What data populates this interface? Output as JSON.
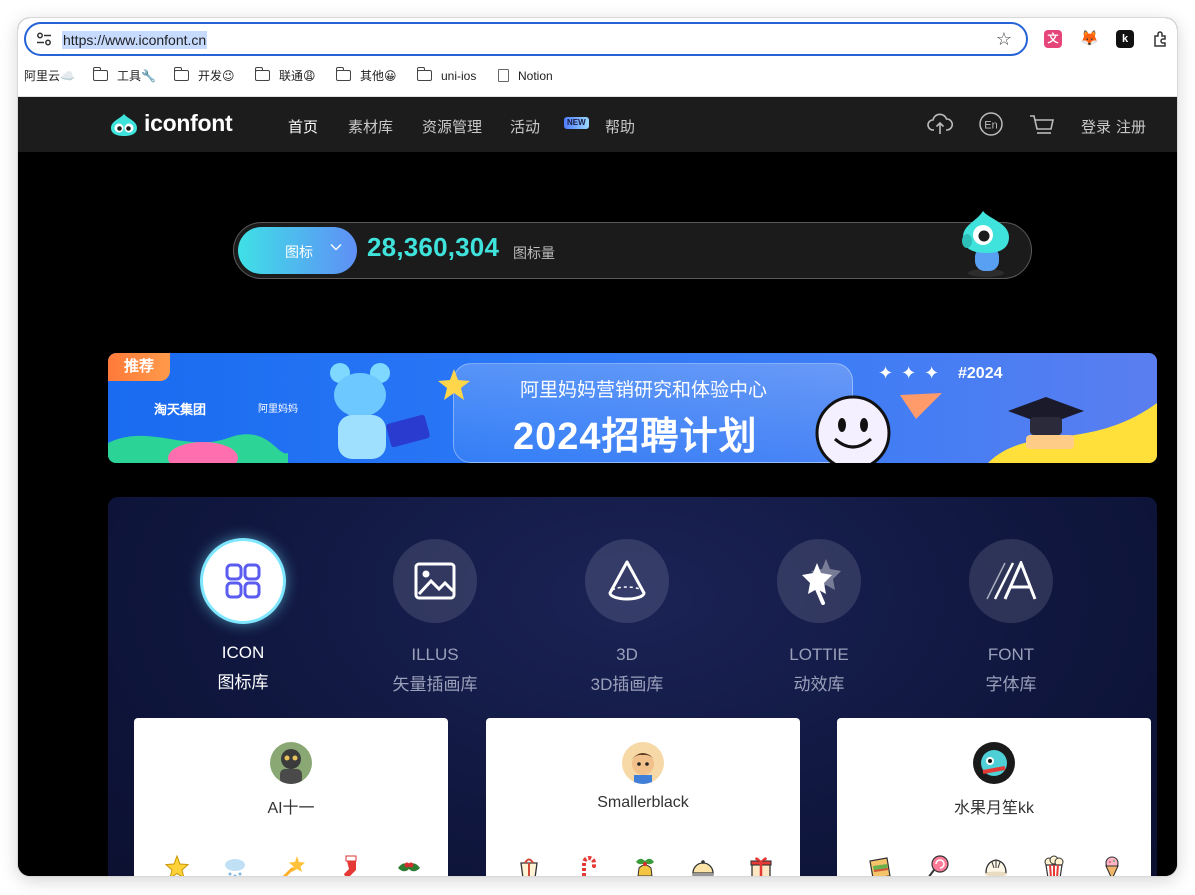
{
  "browser": {
    "url": "https://www.iconfont.cn",
    "bookmarks": [
      {
        "label": "阿里云☁️",
        "type": "text"
      },
      {
        "label": "工具🔧",
        "type": "folder"
      },
      {
        "label": "开发😉",
        "type": "folder"
      },
      {
        "label": "联通😩",
        "type": "folder"
      },
      {
        "label": "其他😀",
        "type": "folder"
      },
      {
        "label": "uni-ios",
        "type": "folder"
      },
      {
        "label": "Notion",
        "type": "doc"
      }
    ],
    "extensions": [
      "translate-ext",
      "metamask-ext",
      "k-ext",
      "puzzle-ext"
    ],
    "ext_k_label": "k"
  },
  "nav": {
    "logo": "iconfont",
    "items": [
      "首页",
      "素材库",
      "资源管理",
      "活动",
      "帮助"
    ],
    "new_badge": "NEW",
    "login": "登录",
    "register": "注册",
    "colors": {
      "bg": "#1c1c1c",
      "active": "#ffffff",
      "inactive": "#c9c9c9"
    }
  },
  "search": {
    "type_label": "图标",
    "count": "28,360,304",
    "count_label": "图标量",
    "accent": "#3fe3dc"
  },
  "banner": {
    "tag": "推荐",
    "brand": "淘天集团",
    "brand2": "阿里妈妈",
    "subtitle": "阿里妈妈营销研究和体验中心",
    "title": "2024招聘计划",
    "hashtag": "#2024"
  },
  "categories": [
    {
      "en": "ICON",
      "zh": "图标库",
      "icon": "grid-icon",
      "active": true
    },
    {
      "en": "ILLUS",
      "zh": "矢量插画库",
      "icon": "image-icon",
      "active": false
    },
    {
      "en": "3D",
      "zh": "3D插画库",
      "icon": "cone-icon",
      "active": false
    },
    {
      "en": "LOTTIE",
      "zh": "动效库",
      "icon": "star-wand-icon",
      "active": false
    },
    {
      "en": "FONT",
      "zh": "字体库",
      "icon": "font-icon",
      "active": false
    }
  ],
  "cards": [
    {
      "name": "AI十一",
      "icons": [
        "star-icon",
        "snow-cloud-icon",
        "shooting-star-icon",
        "stocking-icon",
        "holly-icon"
      ]
    },
    {
      "name": "Smallerblack",
      "icons": [
        "gift-bag-icon",
        "candy-cane-icon",
        "christmas-bell-icon",
        "cloche-icon",
        "gift-box-icon"
      ]
    },
    {
      "name": "水果月笙kk",
      "icons": [
        "taco-icon",
        "lollipop-icon",
        "dumpling-icon",
        "popcorn-icon",
        "ice-cream-icon"
      ]
    }
  ]
}
